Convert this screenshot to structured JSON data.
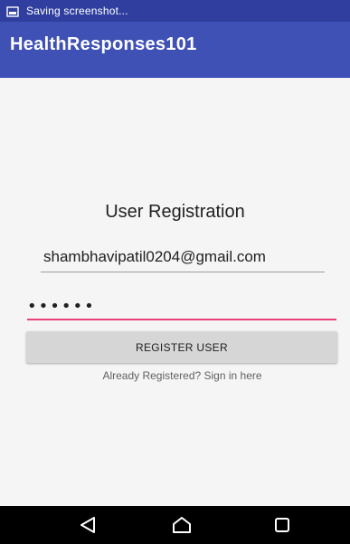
{
  "status_bar": {
    "notification_icon": "screenshot-icon",
    "text": "Saving screenshot..."
  },
  "app_bar": {
    "title": "HealthResponses101",
    "color": "#3f51b5"
  },
  "form": {
    "title": "User Registration",
    "email_value": "shambhavipatil0204@gmail.com",
    "password_value": "••••••",
    "register_label": "REGISTER USER",
    "signin_text": "Already Registered? Sign in here",
    "accent_color": "#ec407a"
  },
  "nav_bar": {
    "back_icon": "back-triangle-icon",
    "home_icon": "home-icon",
    "recents_icon": "recents-square-icon"
  }
}
